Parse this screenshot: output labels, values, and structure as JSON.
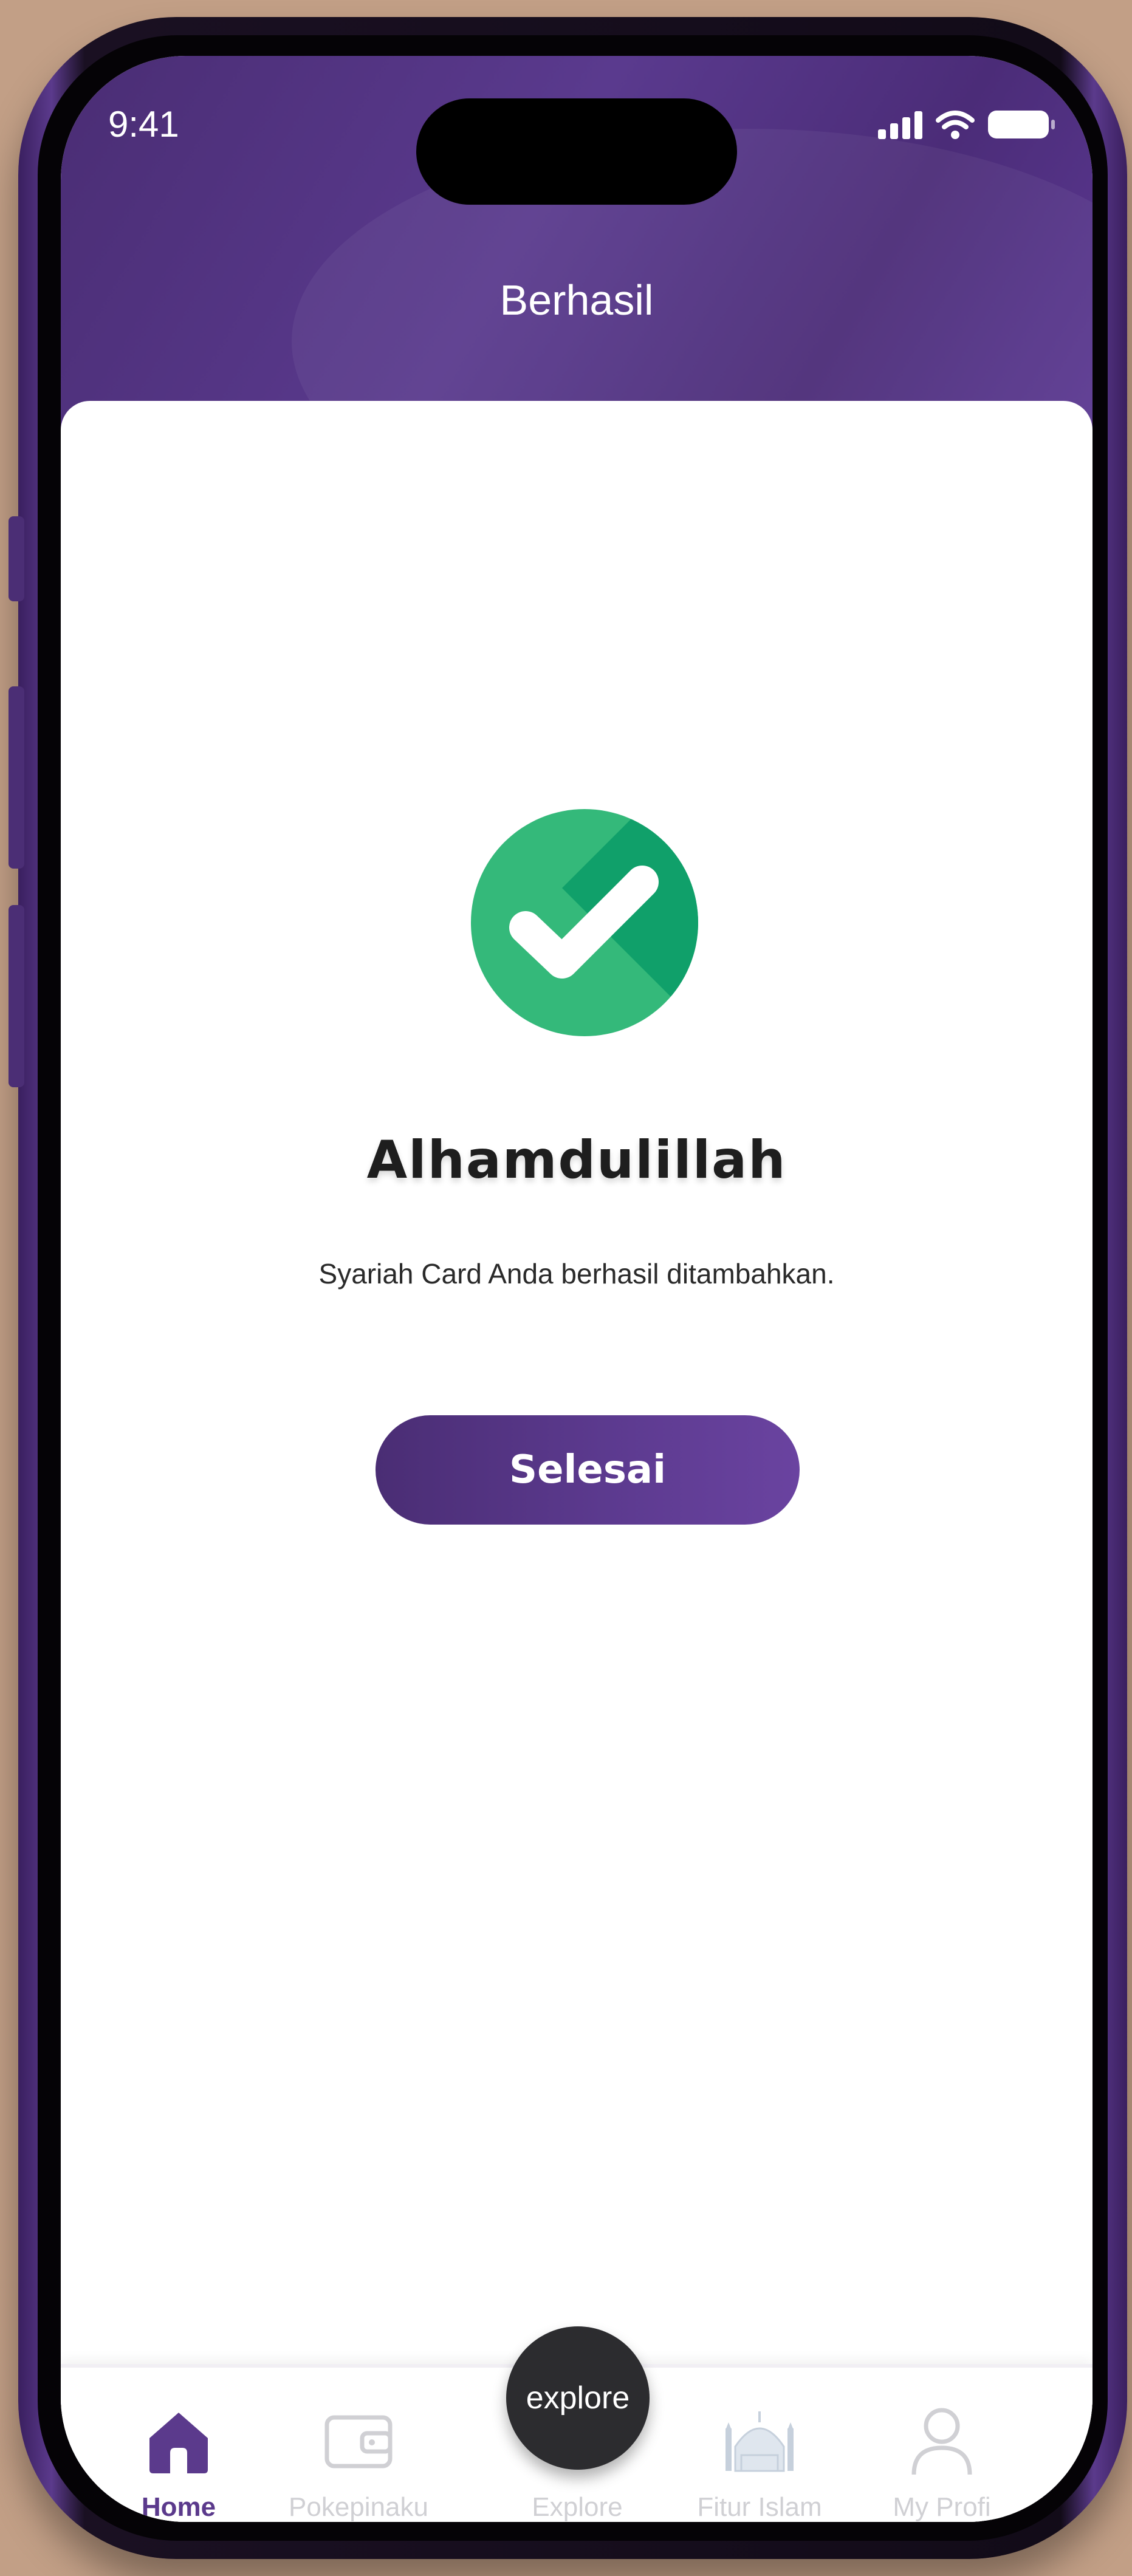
{
  "status_bar": {
    "time": "9:41"
  },
  "header": {
    "title": "Berhasil"
  },
  "success": {
    "title": "Alhamdulillah",
    "message": "Syariah Card Anda berhasil ditambahkan.",
    "button_label": "Selesai"
  },
  "fab": {
    "label": "explore"
  },
  "nav": {
    "items": [
      {
        "label": "Home",
        "icon": "home-icon",
        "active": true
      },
      {
        "label": "Pokepinaku",
        "icon": "wallet-icon",
        "active": false
      },
      {
        "label": "Explore",
        "icon": "explore-icon",
        "active": false
      },
      {
        "label": "Fitur Islam",
        "icon": "mosque-icon",
        "active": false
      },
      {
        "label": "My Profi",
        "icon": "profile-icon",
        "active": false
      }
    ]
  },
  "colors": {
    "primary_purple": "#5b3a8c",
    "success_green": "#34b97a",
    "fab_dark": "#2c2c2f"
  }
}
